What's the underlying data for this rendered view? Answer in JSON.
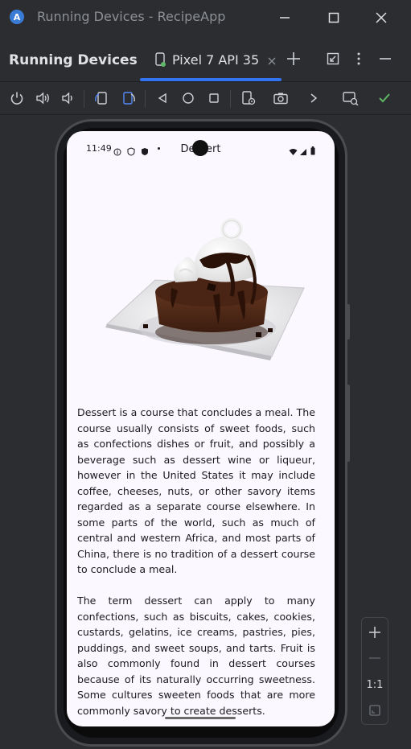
{
  "window": {
    "title": "Running Devices - RecipeApp"
  },
  "tool_window": {
    "title": "Running Devices",
    "tab_label": "Pixel 7 API 35",
    "accent_color": "#3574f0"
  },
  "toolbar": {
    "icons": [
      "power-icon",
      "volume-up-icon",
      "volume-down-icon",
      "rotate-left-icon",
      "rotate-right-icon",
      "back-icon",
      "home-icon",
      "overview-icon",
      "device-settings-icon",
      "screenshot-icon",
      "more-chevron-icon",
      "screen-record-icon",
      "check-icon"
    ]
  },
  "device": {
    "status_time": "11:49",
    "app_title": "Dessert",
    "paragraph_1": "Dessert is a course that concludes a meal. The course usually consists of sweet foods, such as confections dishes or fruit, and possibly a beverage such as dessert wine or liqueur, however in the United States it may include coffee, cheeses, nuts, or other savory items regarded as a separate course elsewhere. In some parts of the world, such as much of central and western Africa, and most parts of China, there is no tradition of a dessert course to conclude a meal.",
    "paragraph_2": "The term dessert can apply to many confections, such as biscuits, cakes, cookies, custards, gelatins, ice creams, pastries, pies, puddings, and sweet soups, and tarts. Fruit is also commonly found in dessert courses because of its naturally occurring sweetness. Some cultures sweeten foods that are more commonly savory to create desserts."
  },
  "zoom": {
    "reset_label": "1:1"
  }
}
